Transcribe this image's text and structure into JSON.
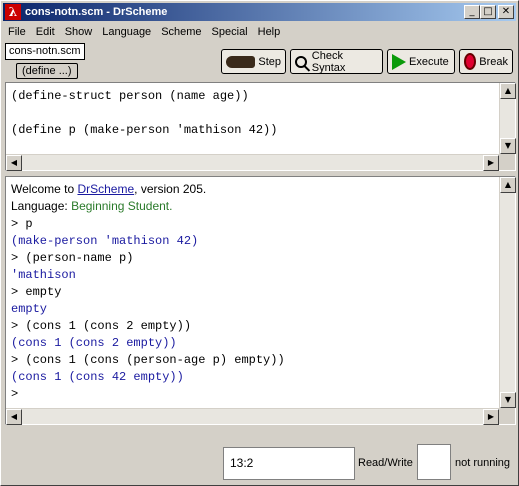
{
  "window": {
    "title": "cons-notn.scm - DrScheme",
    "icon_label": "λ",
    "controls": {
      "minimize": "_",
      "maximize": "□",
      "close": "✕"
    }
  },
  "menu": [
    "File",
    "Edit",
    "Show",
    "Language",
    "Scheme",
    "Special",
    "Help"
  ],
  "toolbar": {
    "file_name": "cons-notn.scm",
    "define_menu": "(define ...)",
    "step_label": "Step",
    "check_syntax_label": "Check Syntax",
    "execute_label": "Execute",
    "break_label": "Break"
  },
  "definitions": [
    "(define-struct person (name age))",
    "(define p (make-person 'mathison 42))"
  ],
  "interactions": {
    "welcome_prefix": "Welcome to ",
    "welcome_link": "DrScheme",
    "welcome_suffix": ", version 205.",
    "language_prefix": "Language: ",
    "language_name": "Beginning Student",
    "language_suffix": ".",
    "lines": [
      {
        "kind": "input",
        "text": "> p"
      },
      {
        "kind": "output",
        "text": "(make-person 'mathison 42)"
      },
      {
        "kind": "input",
        "text": "> (person-name p)"
      },
      {
        "kind": "output",
        "text": "'mathison"
      },
      {
        "kind": "input",
        "text": "> empty"
      },
      {
        "kind": "output",
        "text": "empty"
      },
      {
        "kind": "input",
        "text": "> (cons 1 (cons 2 empty))"
      },
      {
        "kind": "output",
        "text": "(cons 1 (cons 2 empty))"
      },
      {
        "kind": "input",
        "text": "> (cons 1 (cons (person-age p) empty))"
      },
      {
        "kind": "output",
        "text": "(cons 1 (cons 42 empty))"
      },
      {
        "kind": "input",
        "text": ">"
      }
    ]
  },
  "scroll_glyphs": {
    "up": "▲",
    "down": "▼",
    "left": "◀",
    "right": "▶"
  },
  "status": {
    "position": "13:2",
    "mode": "Read/Write",
    "running": "not running"
  },
  "colors": {
    "output": "#1a1aa0",
    "language": "#2a7a2a",
    "break_red": "#e00030",
    "execute_green": "#0a9a0a"
  }
}
